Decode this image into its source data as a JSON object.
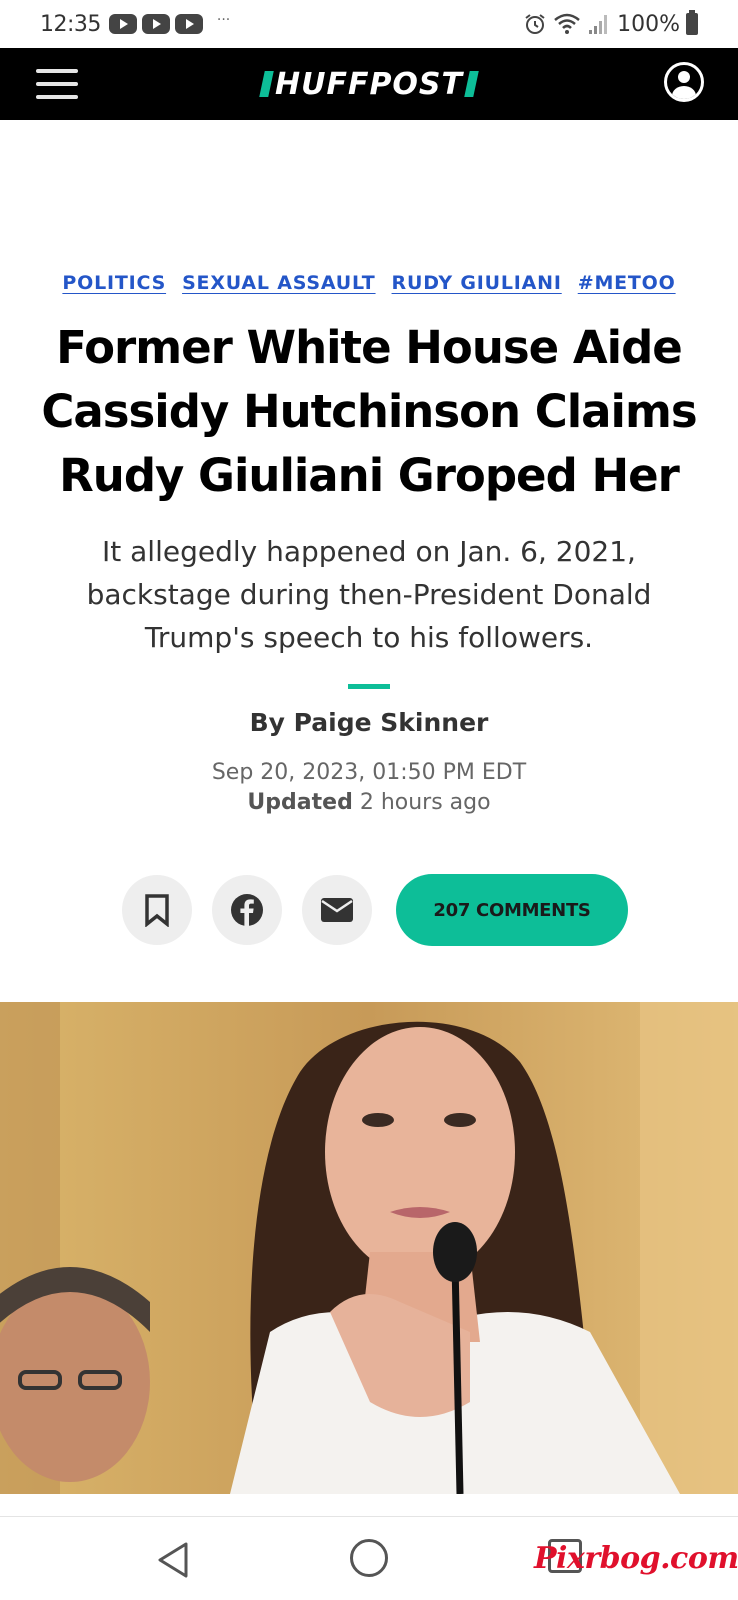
{
  "status_bar": {
    "time": "12:35",
    "dots": "···",
    "battery": "100%",
    "icons": [
      "youtube-icon",
      "youtube-icon",
      "youtube-icon",
      "alarm-icon",
      "wifi-icon",
      "signal-icon",
      "battery-icon"
    ]
  },
  "header": {
    "logo_text": "HUFFPOST",
    "menu_icon": "hamburger-menu-icon",
    "account_icon": "user-account-icon",
    "brand_color": "#0dbe98"
  },
  "article": {
    "tags": [
      "POLITICS",
      "SEXUAL ASSAULT",
      "RUDY GIULIANI",
      "#METOO"
    ],
    "headline": "Former White House Aide Cassidy Hutchinson Claims Rudy Giuliani Groped Her",
    "subheadline": "It allegedly happened on Jan. 6, 2021, backstage during then-President Donald Trump's speech to his followers.",
    "byline": "By Paige Skinner",
    "date": "Sep 20, 2023, 01:50 PM EDT",
    "updated_label": "Updated",
    "updated_value": "2 hours ago"
  },
  "actions": {
    "bookmark_icon": "bookmark-icon",
    "facebook_icon": "facebook-icon",
    "email_icon": "envelope-icon",
    "comments_label": "207 COMMENTS"
  },
  "nav_bar": {
    "back_icon": "back-triangle-icon",
    "home_icon": "home-circle-icon",
    "recent_icon": "recent-apps-icon"
  },
  "watermark": "Pixrbog.com",
  "colors": {
    "tag_link": "#2456c8",
    "accent_green": "#0dbe98",
    "header_bg": "#000000"
  }
}
